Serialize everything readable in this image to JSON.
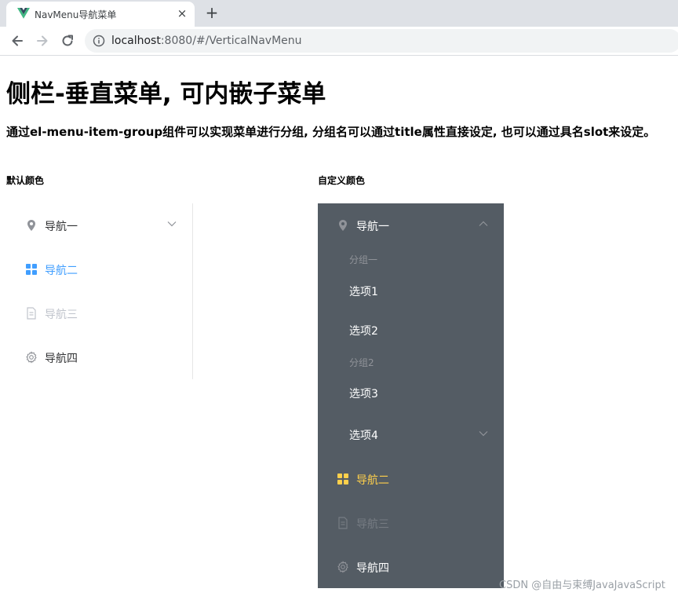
{
  "browser": {
    "tab_title": "NavMenu导航菜单",
    "close_glyph": "×",
    "new_tab_glyph": "+",
    "url_host": "localhost",
    "url_path": ":8080/#/VerticalNavMenu",
    "icons": [
      "vue-logo-icon",
      "back-arrow-icon",
      "forward-arrow-icon",
      "reload-icon",
      "info-icon"
    ]
  },
  "page": {
    "title": "侧栏-垂直菜单, 可内嵌子菜单",
    "description": "通过el-menu-item-group组件可以实现菜单进行分组, 分组名可以通过title属性直接设定, 也可以通过具名slot来设定。"
  },
  "default_menu": {
    "label": "默认颜色",
    "colors": {
      "text": "#303133",
      "active": "#409eff",
      "disabled": "#c0c4cc",
      "border": "#e6e6e6"
    },
    "items": [
      {
        "label": "导航一",
        "icon": "location-icon",
        "has_submenu": true,
        "state": "normal"
      },
      {
        "label": "导航二",
        "icon": "menu-grid-icon",
        "state": "active"
      },
      {
        "label": "导航三",
        "icon": "document-icon",
        "state": "disabled"
      },
      {
        "label": "导航四",
        "icon": "setting-icon",
        "state": "normal"
      }
    ]
  },
  "custom_menu": {
    "label": "自定义颜色",
    "colors": {
      "background": "#545c64",
      "text": "#ffffff",
      "active": "#ffd04b",
      "group_title": "#909399"
    },
    "items": [
      {
        "label": "导航一",
        "icon": "location-icon",
        "expanded": true
      },
      {
        "label": "导航二",
        "icon": "menu-grid-icon",
        "state": "active"
      },
      {
        "label": "导航三",
        "icon": "document-icon",
        "state": "disabled"
      },
      {
        "label": "导航四",
        "icon": "setting-icon",
        "state": "normal"
      }
    ],
    "groups": [
      {
        "title": "分组一",
        "options": [
          "选项1",
          "选项2"
        ]
      },
      {
        "title": "分组2",
        "options": [
          "选项3"
        ]
      }
    ],
    "option4": "选项4"
  },
  "watermark": "CSDN @自由与束缚JavaJavaScript"
}
